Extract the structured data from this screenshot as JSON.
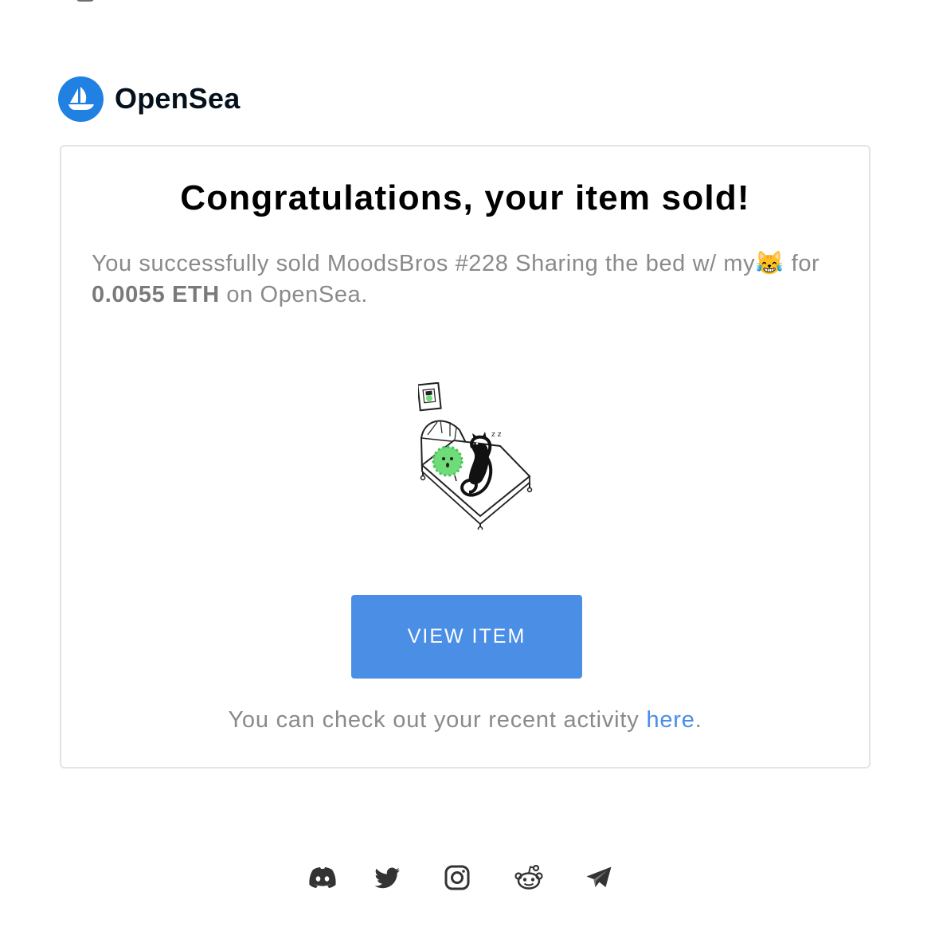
{
  "brand": {
    "name": "OpenSea",
    "accent_color": "#2081e2"
  },
  "email": {
    "headline": "Congratulations, your item sold!",
    "message": {
      "prefix": "You successfully sold ",
      "item_name": "MoodsBros #228 Sharing the bed w/ my😹",
      "middle": " for ",
      "price": "0.0055 ETH",
      "suffix": " on OpenSea."
    },
    "button_label": "VIEW ITEM",
    "button_color": "#4a8ee6",
    "activity": {
      "text": "You can check out your recent activity ",
      "link_text": "here",
      "suffix": "."
    }
  },
  "footer": {
    "social_icons": [
      "discord-icon",
      "twitter-icon",
      "instagram-icon",
      "reddit-icon",
      "telegram-icon"
    ]
  }
}
